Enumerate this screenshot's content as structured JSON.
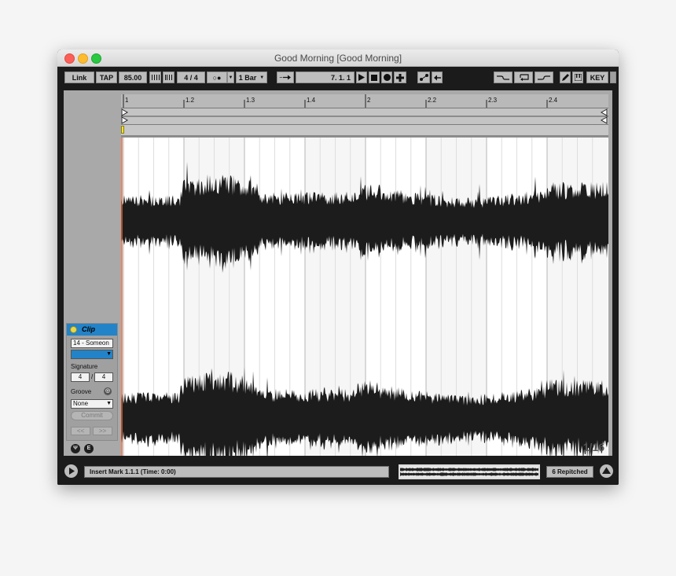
{
  "window": {
    "title": "Good Morning  [Good Morning]"
  },
  "toolbar": {
    "link": "Link",
    "tap": "TAP",
    "tempo": "85.00",
    "signature": "4 / 4",
    "metronome": "○●",
    "quantize": "1 Bar",
    "position": "7.  1.  1",
    "key": "KEY"
  },
  "ruler": {
    "ticks": [
      "1",
      "1.2",
      "1.3",
      "1.4",
      "2",
      "2.2",
      "2.3",
      "2.4"
    ]
  },
  "clip": {
    "header": "Clip",
    "name": "14 - Someon",
    "signature_label": "Signature",
    "sig_num": "4",
    "sig_sep": "/",
    "sig_den": "4",
    "groove_label": "Groove",
    "groove_value": "None",
    "commit": "Commit",
    "nav_prev": "<<",
    "nav_next": ">>"
  },
  "editor": {
    "zoom": "1/16"
  },
  "status": {
    "message": "Insert Mark 1.1.1 (Time: 0:00)",
    "repitch": "6 Repitched"
  },
  "colors": {
    "clip_header": "#2283c8",
    "playhead": "#e06030",
    "waveform": "#1c1c1c",
    "start_marker": "#f2e233"
  },
  "icons": [
    "play-icon",
    "stop-icon",
    "record-icon",
    "plus-icon",
    "pencil-icon",
    "keyboard-icon",
    "scroll-up-icon"
  ]
}
